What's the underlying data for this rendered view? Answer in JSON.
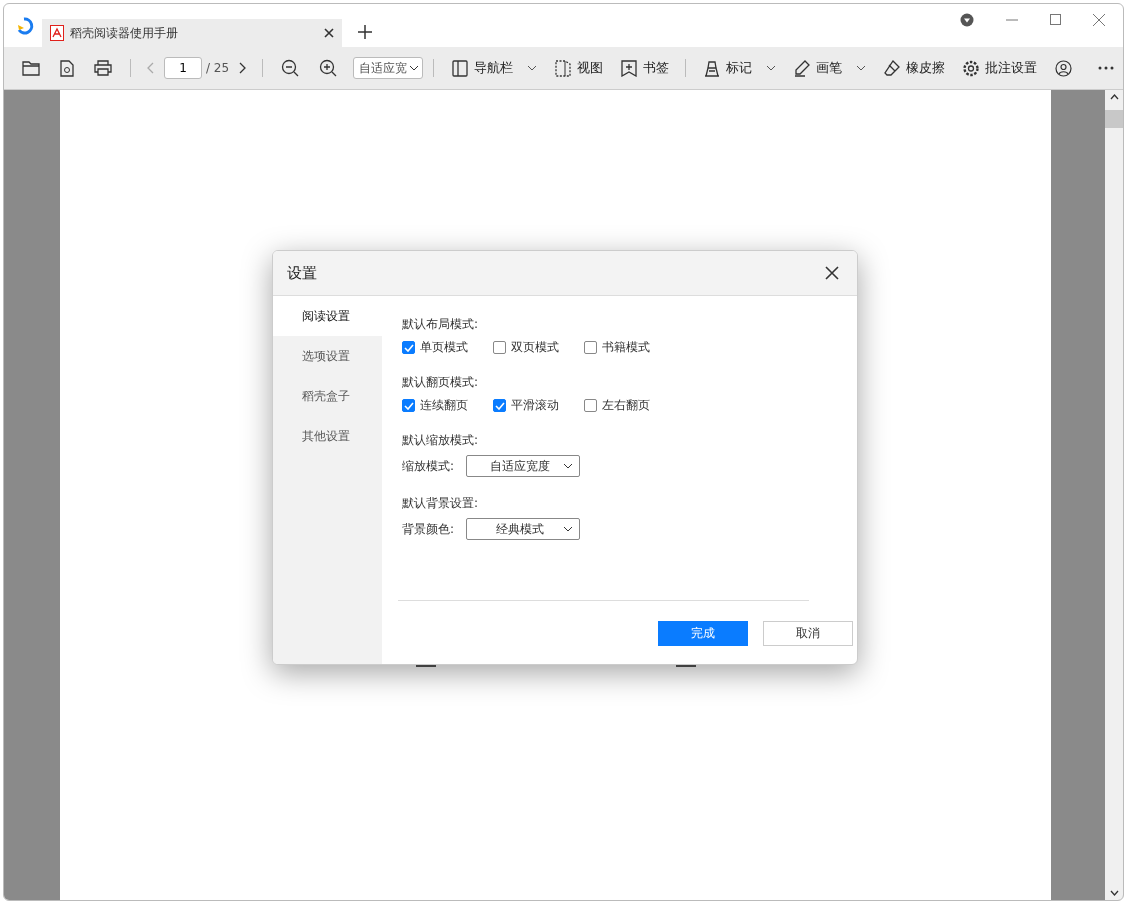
{
  "tabs": [
    {
      "title": "稻壳阅读器使用手册",
      "selected": true
    }
  ],
  "toolbar": {
    "page_input": "1",
    "page_total": "/ 25",
    "zoom": "自适应宽",
    "items": [
      {
        "label": "导航栏",
        "dropdown": true
      },
      {
        "label": "视图",
        "dropdown": false
      },
      {
        "label": "书签",
        "dropdown": false
      },
      {
        "label": "标记",
        "dropdown": true
      },
      {
        "label": "画笔",
        "dropdown": true
      },
      {
        "label": "橡皮擦",
        "dropdown": false
      },
      {
        "label": "批注设置",
        "dropdown": false
      }
    ]
  },
  "dialog": {
    "title": "设置",
    "sidebar": [
      {
        "label": "阅读设置",
        "selected": true
      },
      {
        "label": "选项设置",
        "selected": false
      },
      {
        "label": "稻壳盒子",
        "selected": false
      },
      {
        "label": "其他设置",
        "selected": false
      }
    ],
    "sections": [
      {
        "heading": "默认布局模式:",
        "kind": "checkboxes",
        "options": [
          {
            "label": "单页模式",
            "checked": true
          },
          {
            "label": "双页模式",
            "checked": false
          },
          {
            "label": "书籍模式",
            "checked": false
          }
        ]
      },
      {
        "heading": "默认翻页模式:",
        "kind": "checkboxes",
        "options": [
          {
            "label": "连续翻页",
            "checked": true
          },
          {
            "label": "平滑滚动",
            "checked": true
          },
          {
            "label": "左右翻页",
            "checked": false
          }
        ]
      },
      {
        "heading": "默认缩放模式:",
        "kind": "select",
        "label": "缩放模式:",
        "value": "自适应宽度"
      },
      {
        "heading": "默认背景设置:",
        "kind": "select",
        "label": "背景颜色:",
        "value": "经典模式"
      }
    ],
    "buttons": [
      {
        "label": "完成",
        "primary": true
      },
      {
        "label": "取消",
        "primary": false
      }
    ]
  }
}
